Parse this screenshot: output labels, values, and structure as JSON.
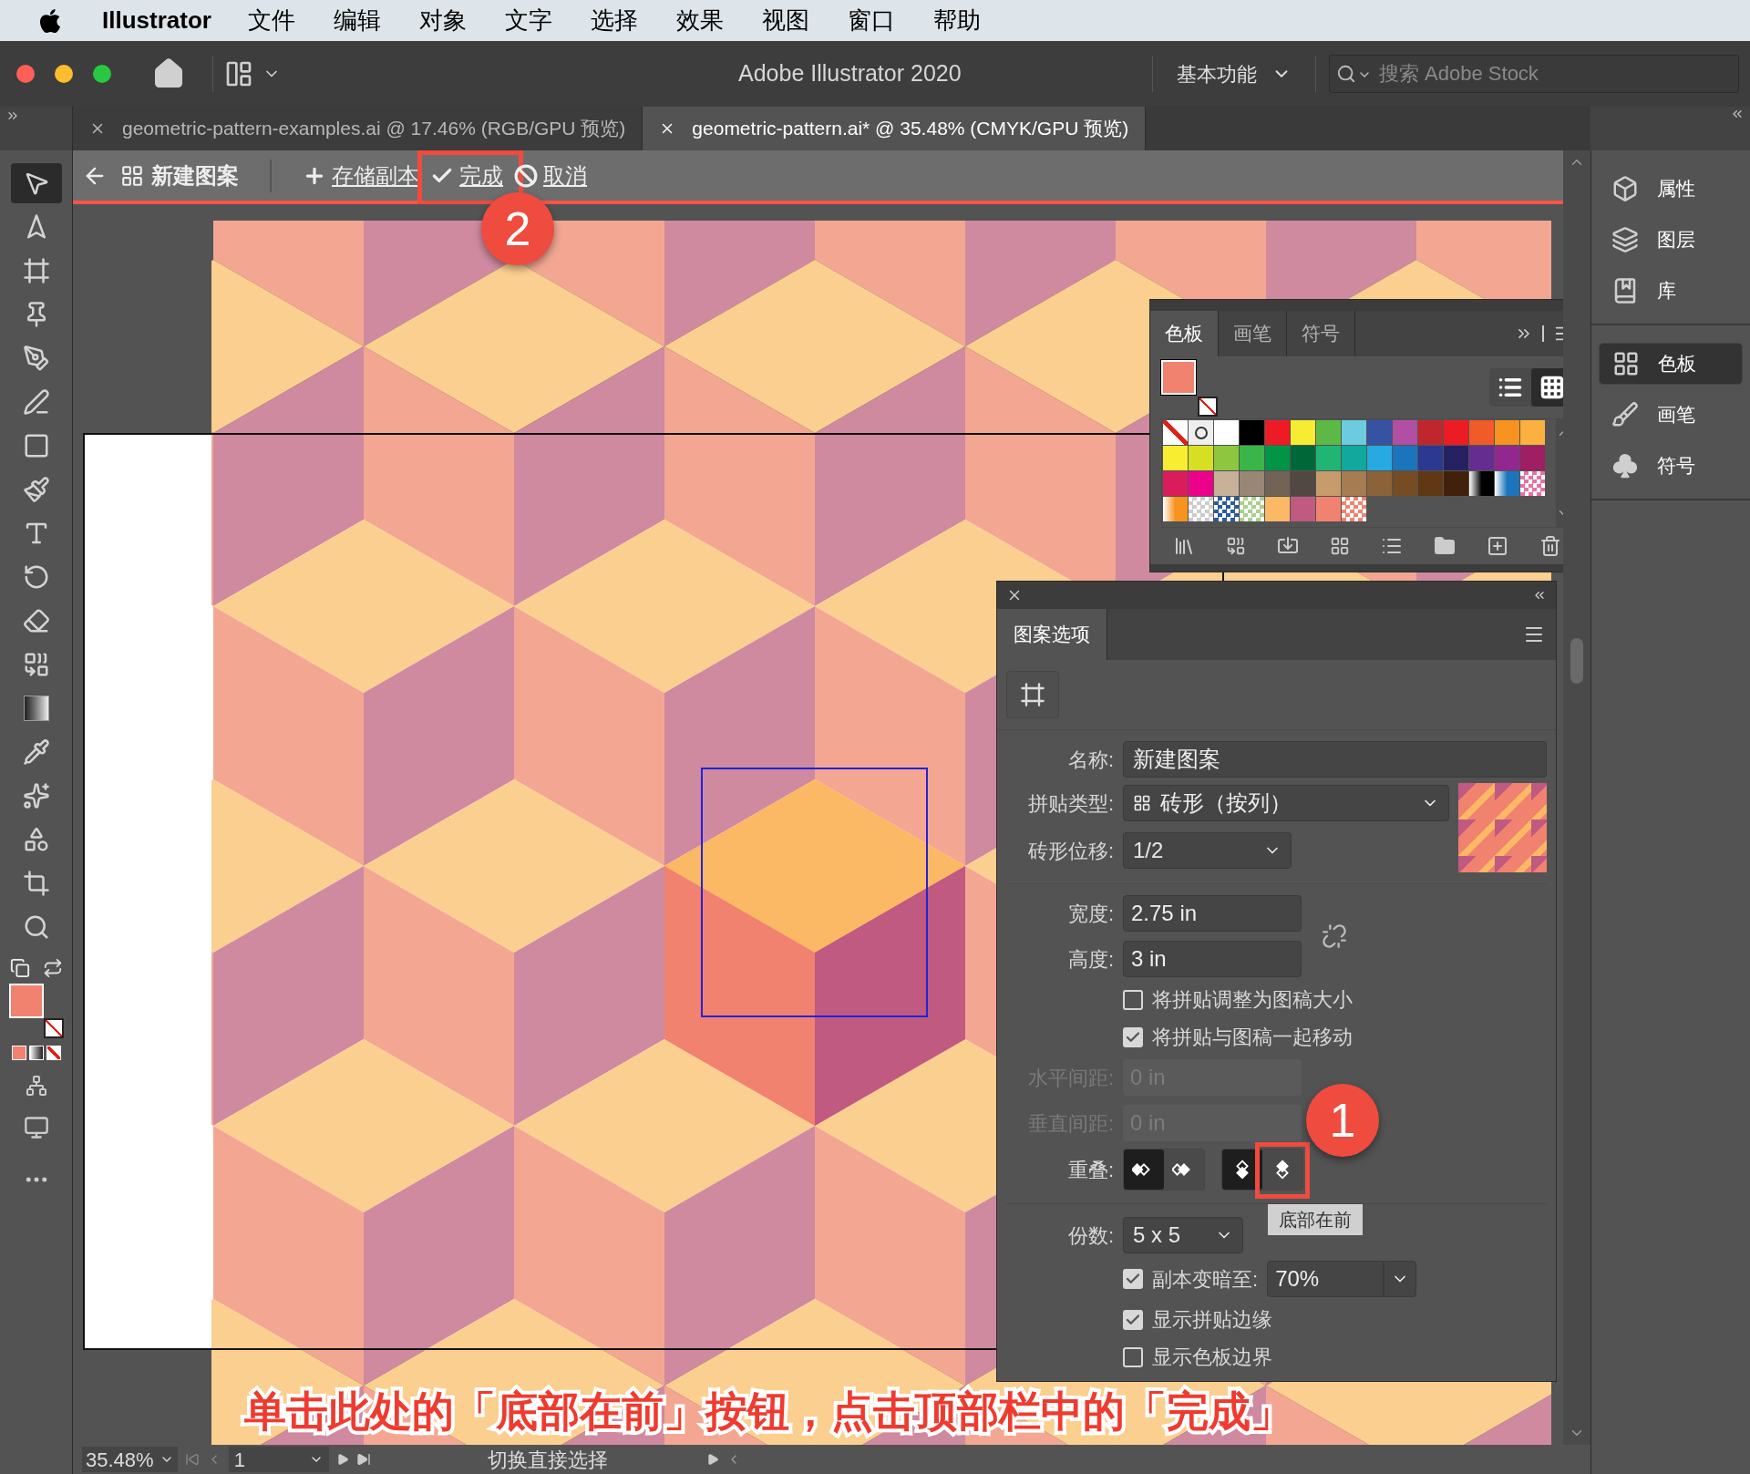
{
  "menu_bar": {
    "app": "Illustrator",
    "items": [
      "文件",
      "编辑",
      "对象",
      "文字",
      "选择",
      "效果",
      "视图",
      "窗口",
      "帮助"
    ]
  },
  "title_bar": {
    "title": "Adobe Illustrator 2020",
    "workspace": "基本功能",
    "search_placeholder": "搜索 Adobe Stock"
  },
  "document_tabs": [
    {
      "label": "geometric-pattern-examples.ai @ 17.46% (RGB/GPU 预览)",
      "selected": false
    },
    {
      "label": "geometric-pattern.ai* @ 35.48% (CMYK/GPU 预览)",
      "selected": true
    }
  ],
  "pattern_bar": {
    "title": "新建图案",
    "actions": [
      {
        "kind": "save",
        "label": "存储副本"
      },
      {
        "kind": "done",
        "label": "完成",
        "callout": "2"
      },
      {
        "kind": "cancel",
        "label": "取消"
      }
    ]
  },
  "tools": [
    {
      "kind": "selection",
      "selected": true
    },
    {
      "kind": "direct",
      "selected": false
    },
    {
      "kind": "artboard",
      "selected": false
    },
    {
      "kind": "pin",
      "selected": false
    },
    {
      "kind": "pen",
      "selected": false
    },
    {
      "kind": "curvature",
      "selected": false
    },
    {
      "kind": "rectangle",
      "selected": false
    },
    {
      "kind": "brush",
      "selected": false
    },
    {
      "kind": "type",
      "selected": false
    },
    {
      "kind": "rotate",
      "selected": false
    },
    {
      "kind": "eraser",
      "selected": false
    },
    {
      "kind": "shape_builder",
      "selected": false
    },
    {
      "kind": "gradient",
      "selected": false
    },
    {
      "kind": "eyedropper",
      "selected": false
    },
    {
      "kind": "puppet",
      "selected": false
    },
    {
      "kind": "shapes",
      "selected": false
    },
    {
      "kind": "crop",
      "selected": false
    },
    {
      "kind": "zoom",
      "selected": false
    }
  ],
  "toolbar_fill": {
    "color": "#f0826f"
  },
  "swatches_panel": {
    "tabs": [
      {
        "label": "色板",
        "selected": true
      },
      {
        "label": "画笔",
        "selected": false
      },
      {
        "label": "符号",
        "selected": false
      }
    ],
    "fill": {
      "color": "#f0826f"
    },
    "view_modes": [
      {
        "kind": "list",
        "selected": false
      },
      {
        "kind": "grid",
        "selected": true
      }
    ],
    "swatches": [
      {
        "kind": "none"
      },
      {
        "kind": "registration"
      },
      {
        "kind": "color",
        "color": "#ffffff"
      },
      {
        "kind": "color",
        "color": "#000000"
      },
      {
        "kind": "color",
        "color": "#ed1c24"
      },
      {
        "kind": "color",
        "color": "#f7ec31"
      },
      {
        "kind": "color",
        "color": "#5cb946"
      },
      {
        "kind": "color",
        "color": "#6dcbe0"
      },
      {
        "kind": "color",
        "color": "#3552a3"
      },
      {
        "kind": "color",
        "color": "#b04fa3"
      },
      {
        "kind": "color",
        "color": "#c0272d"
      },
      {
        "kind": "color",
        "color": "#ed1c24"
      },
      {
        "kind": "color",
        "color": "#f15a29"
      },
      {
        "kind": "color",
        "color": "#f7931e"
      },
      {
        "kind": "color",
        "color": "#fbb040"
      },
      {
        "kind": "color",
        "color": "#f9ed32"
      },
      {
        "kind": "color",
        "color": "#d7df23"
      },
      {
        "kind": "color",
        "color": "#8dc63f"
      },
      {
        "kind": "color",
        "color": "#39b54a"
      },
      {
        "kind": "color",
        "color": "#009444"
      },
      {
        "kind": "color",
        "color": "#006838"
      },
      {
        "kind": "color",
        "color": "#21b573"
      },
      {
        "kind": "color",
        "color": "#12a89d"
      },
      {
        "kind": "color",
        "color": "#27aae1"
      },
      {
        "kind": "color",
        "color": "#1c75bc"
      },
      {
        "kind": "color",
        "color": "#2b3990"
      },
      {
        "kind": "color",
        "color": "#262262"
      },
      {
        "kind": "color",
        "color": "#662d91"
      },
      {
        "kind": "color",
        "color": "#92278f"
      },
      {
        "kind": "color",
        "color": "#9e1f63"
      },
      {
        "kind": "color",
        "color": "#da1c5c"
      },
      {
        "kind": "color",
        "color": "#ec008c"
      },
      {
        "kind": "color",
        "color": "#c7b299"
      },
      {
        "kind": "color",
        "color": "#998675"
      },
      {
        "kind": "color",
        "color": "#736357"
      },
      {
        "kind": "color",
        "color": "#534741"
      },
      {
        "kind": "color",
        "color": "#c69c6d"
      },
      {
        "kind": "color",
        "color": "#a67c52"
      },
      {
        "kind": "color",
        "color": "#8c6239"
      },
      {
        "kind": "color",
        "color": "#754c24"
      },
      {
        "kind": "color",
        "color": "#603813"
      },
      {
        "kind": "color",
        "color": "#42210b"
      },
      {
        "kind": "gradient",
        "color": "#000000"
      },
      {
        "kind": "gradient",
        "color": "#1c75bc"
      },
      {
        "kind": "pattern",
        "color": "#ec6fa0"
      },
      {
        "kind": "gradient",
        "color": "#f7931e"
      },
      {
        "kind": "pattern",
        "color": "#cccccc"
      },
      {
        "kind": "pattern",
        "color": "#2b5aa0"
      },
      {
        "kind": "pattern",
        "color": "#a8d08d"
      },
      {
        "kind": "color",
        "color": "#fbb865"
      },
      {
        "kind": "color",
        "color": "#c05a80"
      },
      {
        "kind": "color",
        "color": "#f0826f"
      },
      {
        "kind": "pattern",
        "color": "#f0826f"
      }
    ]
  },
  "pattern_options": {
    "title": "图案选项",
    "name": {
      "label": "名称:",
      "value": "新建图案"
    },
    "tile_type": {
      "label": "拼贴类型:",
      "value": "砖形（按列）"
    },
    "brick_offset": {
      "label": "砖形位移:",
      "value": "1/2"
    },
    "width": {
      "label": "宽度:",
      "value": "2.75 in"
    },
    "height": {
      "label": "高度:",
      "value": "3 in"
    },
    "tile_checkboxes": [
      {
        "label": "将拼贴调整为图稿大小",
        "checked": false
      },
      {
        "label": "将拼贴与图稿一起移动",
        "checked": true
      }
    ],
    "spacing": [
      {
        "label": "水平间距:",
        "value": "0 in",
        "disabled": true
      },
      {
        "label": "垂直间距:",
        "value": "0 in",
        "disabled": true
      }
    ],
    "overlap": {
      "label": "重叠:",
      "buttons": [
        {
          "kind": "left",
          "selected": true
        },
        {
          "kind": "right",
          "selected": false
        },
        {
          "kind": "top",
          "selected": true
        },
        {
          "kind": "bottom",
          "selected": false,
          "callout": "1",
          "tooltip": "底部在前"
        }
      ]
    },
    "copies": {
      "label": "份数:",
      "value": "5 x 5"
    },
    "dim": {
      "label": "副本变暗至:",
      "checked": true,
      "value": "70%"
    },
    "view_checkboxes": [
      {
        "label": "显示拼贴边缘",
        "checked": true
      },
      {
        "label": "显示色板边界",
        "checked": false
      }
    ]
  },
  "right_dock": {
    "groups": [
      [
        {
          "kind": "properties",
          "label": "属性",
          "selected": false
        },
        {
          "kind": "layers",
          "label": "图层",
          "selected": false
        },
        {
          "kind": "libraries",
          "label": "库",
          "selected": false
        }
      ],
      [
        {
          "kind": "swatches",
          "label": "色板",
          "selected": true
        },
        {
          "kind": "brushes",
          "label": "画笔",
          "selected": false
        },
        {
          "kind": "symbols",
          "label": "符号",
          "selected": false
        }
      ]
    ]
  },
  "caption": "单击此处的「底部在前」按钮，点击顶部栏中的「完成」",
  "status_bar": {
    "zoom": "35.48%",
    "artboard": "1",
    "tool": "切换直接选择"
  }
}
